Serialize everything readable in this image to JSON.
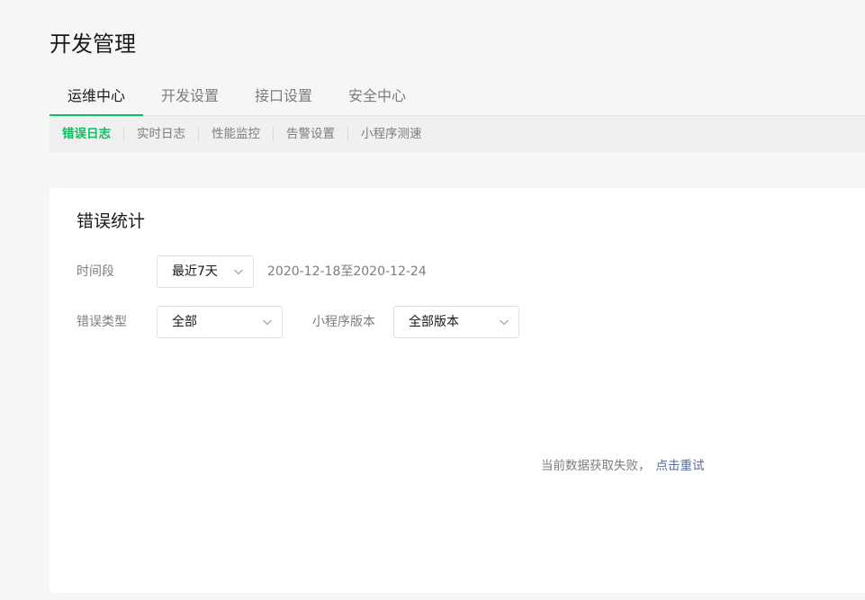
{
  "page": {
    "title": "开发管理"
  },
  "tabs": [
    {
      "label": "运维中心",
      "active": true
    },
    {
      "label": "开发设置",
      "active": false
    },
    {
      "label": "接口设置",
      "active": false
    },
    {
      "label": "安全中心",
      "active": false
    }
  ],
  "subnav": [
    {
      "label": "错误日志",
      "active": true
    },
    {
      "label": "实时日志",
      "active": false
    },
    {
      "label": "性能监控",
      "active": false
    },
    {
      "label": "告警设置",
      "active": false
    },
    {
      "label": "小程序测速",
      "active": false
    }
  ],
  "card": {
    "title": "错误统计",
    "filters": {
      "period_label": "时间段",
      "period_value": "最近7天",
      "date_range": "2020-12-18至2020-12-24",
      "error_type_label": "错误类型",
      "error_type_value": "全部",
      "version_label": "小程序版本",
      "version_value": "全部版本"
    },
    "empty_state": {
      "message": "当前数据获取失败，",
      "retry": "点击重试"
    }
  },
  "colors": {
    "accent": "#07c160",
    "link": "#576b95",
    "muted": "#7d7d7d"
  },
  "icons": [
    "chevron-down-icon"
  ]
}
